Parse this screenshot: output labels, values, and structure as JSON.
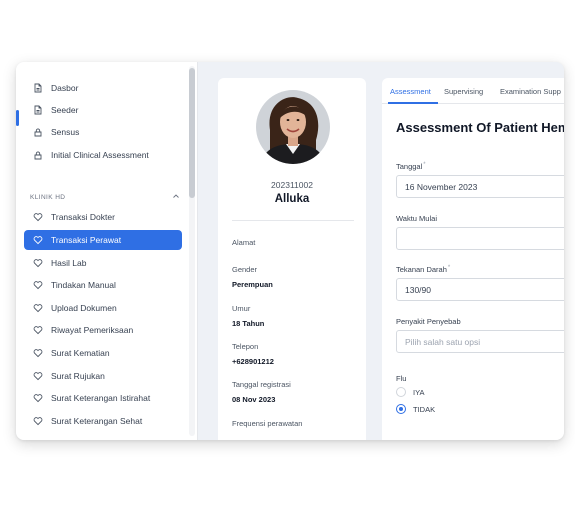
{
  "colors": {
    "accent": "#2f6fe4",
    "panel_bg": "#eef1f6"
  },
  "sidebar": {
    "top_items": [
      {
        "label": "Dasbor",
        "icon": "file-icon"
      },
      {
        "label": "Seeder",
        "icon": "file-icon"
      },
      {
        "label": "Sensus",
        "icon": "lock-icon"
      },
      {
        "label": "Initial Clinical Assessment",
        "icon": "lock-icon"
      }
    ],
    "section": {
      "label": "KLINIK HD",
      "toggle_icon": "chevron-up-icon"
    },
    "section_items": [
      {
        "label": "Transaksi Dokter",
        "icon": "heart-icon"
      },
      {
        "label": "Transaksi Perawat",
        "icon": "heart-icon",
        "active": true
      },
      {
        "label": "Hasil Lab",
        "icon": "heart-icon"
      },
      {
        "label": "Tindakan Manual",
        "icon": "heart-icon"
      },
      {
        "label": "Upload Dokumen",
        "icon": "heart-icon"
      },
      {
        "label": "Riwayat Pemeriksaan",
        "icon": "heart-icon"
      },
      {
        "label": "Surat Kematian",
        "icon": "heart-icon"
      },
      {
        "label": "Surat Rujukan",
        "icon": "heart-icon"
      },
      {
        "label": "Surat Keterangan Istirahat",
        "icon": "heart-icon"
      },
      {
        "label": "Surat Keterangan Sehat",
        "icon": "heart-icon"
      }
    ]
  },
  "patient": {
    "id": "202311002",
    "name": "Alluka",
    "fields": [
      {
        "label": "Alamat",
        "value": ""
      },
      {
        "label": "Gender",
        "value": "Perempuan"
      },
      {
        "label": "Umur",
        "value": "18 Tahun"
      },
      {
        "label": "Telepon",
        "value": "+628901212"
      },
      {
        "label": "Tanggal registrasi",
        "value": "08 Nov 2023"
      },
      {
        "label": "Frequensi perawatan",
        "value": ""
      }
    ]
  },
  "form": {
    "tabs": [
      "Assessment",
      "Supervising",
      "Examination Supp"
    ],
    "title": "Assessment Of Patient Hem",
    "fields": {
      "tanggal": {
        "label": "Tanggal",
        "required_mark": "*",
        "value": "16 November 2023"
      },
      "waktu": {
        "label": "Waktu Mulai",
        "value": ""
      },
      "tekanan": {
        "label": "Tekanan Darah",
        "required_mark": "*",
        "value": "130/90"
      },
      "penyakit": {
        "label": "Penyakit Penyebab",
        "placeholder": "Pilih salah satu opsi"
      }
    },
    "flu": {
      "label": "Flu",
      "options": [
        {
          "label": "IYA",
          "checked": false
        },
        {
          "label": "TIDAK",
          "checked": true
        }
      ]
    }
  }
}
